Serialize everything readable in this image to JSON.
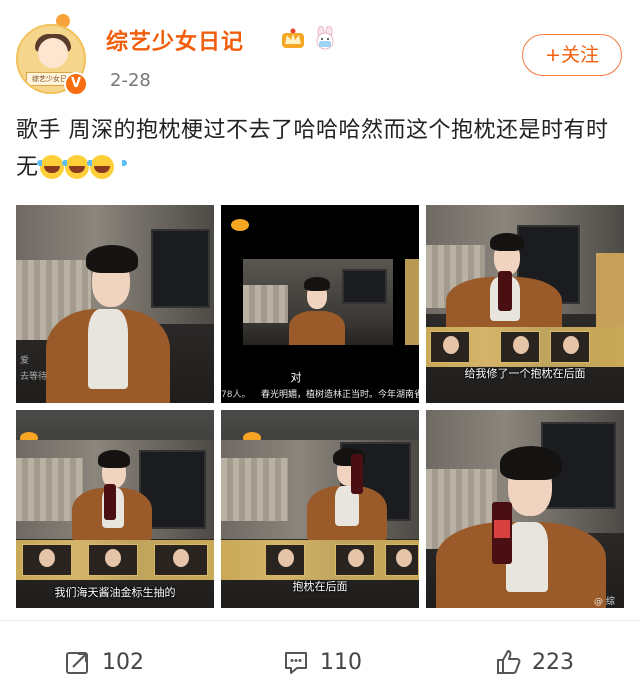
{
  "user": {
    "name": "综艺少女日记",
    "avatar_caption": "综艺少女日记",
    "verified_label": "V",
    "date": "2-28",
    "follow_label": "+关注"
  },
  "post": {
    "text": "歌手 周深的抱枕梗过不去了哈哈哈然而这个抱枕还是时有时无",
    "emoji_name": "laugh-cry-icon",
    "emoji_count": 3
  },
  "photos": [
    {
      "side_caption_1": "爱",
      "side_caption_2": "去等待"
    },
    {
      "subtitle": "对",
      "ticker": "春光明媚，植树造林正当时。今年湖南省全省计划完",
      "side_note": "78人。"
    },
    {
      "subtitle": "给我修了一个抱枕在后面"
    },
    {
      "subtitle": "我们海天酱油金标生抽的"
    },
    {
      "subtitle": "抱枕在后面"
    },
    {
      "watermark": "@ 综"
    }
  ],
  "actions": {
    "repost_count": "102",
    "comment_count": "110",
    "like_count": "223"
  },
  "colors": {
    "brand": "#f25d0b",
    "verified": "#f76d0f",
    "text": "#222222",
    "muted": "#777777"
  }
}
